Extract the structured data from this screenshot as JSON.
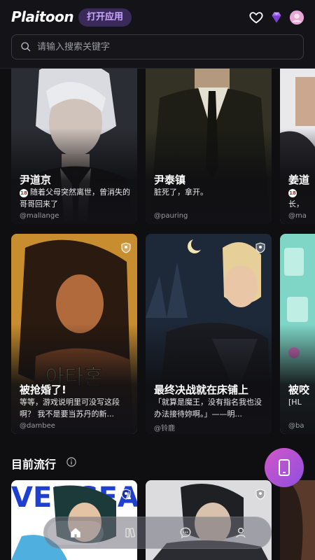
{
  "header": {
    "logo": "Plaitoon",
    "open_app_label": "打开应用"
  },
  "search": {
    "placeholder": "请输入搜索关键字"
  },
  "cards_row1": [
    {
      "title": "尹道京",
      "desc": "随着父母突然离世，曾消失的哥哥回来了",
      "adult": true,
      "author": "@mallange"
    },
    {
      "title": "尹泰镇",
      "desc": "脏死了，拿开。",
      "adult": false,
      "author": "@pauring"
    },
    {
      "title": "姜道",
      "desc": "长，",
      "adult": true,
      "author": "@ma"
    }
  ],
  "cards_row2": [
    {
      "title": "被抢婚了!",
      "desc": "等等，游戏说明里可没写这段啊？ 我不是要当苏丹的新...",
      "author": "@dambee"
    },
    {
      "title": "最终决战就在床铺上",
      "desc": "「就算是魔王，没有指名我也没办法接待妳啊。」——明...",
      "author": "@铃鹿"
    },
    {
      "title": "被咬",
      "desc": "[HL",
      "author": "@ba"
    }
  ],
  "section": {
    "title": "目前流行"
  },
  "tabbar": {
    "items": [
      "home",
      "library",
      "chat",
      "profile"
    ]
  },
  "colors": {
    "accent": "#8f4fe0",
    "bg": "#0f0f12"
  }
}
